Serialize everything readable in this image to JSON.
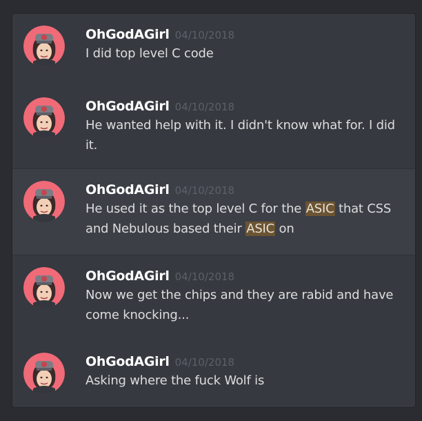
{
  "messages": [
    {
      "author": "OhGodAGirl",
      "timestamp": "04/10/2018",
      "parts": [
        {
          "text": "I did top level C code",
          "highlight": false
        }
      ]
    },
    {
      "author": "OhGodAGirl",
      "timestamp": "04/10/2018",
      "parts": [
        {
          "text": "He wanted help with it. I didn't know what for. I did it.",
          "highlight": false
        }
      ]
    },
    {
      "author": "OhGodAGirl",
      "timestamp": "04/10/2018",
      "highlighted": true,
      "parts": [
        {
          "text": "He used it as the top level C for the ",
          "highlight": false
        },
        {
          "text": "ASIC",
          "highlight": true
        },
        {
          "text": " that CSS and Nebulous based their ",
          "highlight": false
        },
        {
          "text": "ASIC",
          "highlight": true
        },
        {
          "text": " on",
          "highlight": false
        }
      ]
    },
    {
      "author": "OhGodAGirl",
      "timestamp": "04/10/2018",
      "parts": [
        {
          "text": "Now we get the chips and they are rabid and have come knocking...",
          "highlight": false
        }
      ]
    },
    {
      "author": "OhGodAGirl",
      "timestamp": "04/10/2018",
      "parts": [
        {
          "text": "Asking where the fuck Wolf is",
          "highlight": false
        }
      ]
    }
  ],
  "colors": {
    "background": "#2a2c31",
    "panel": "#36393f",
    "highlight_row": "#3c3f46",
    "mention_highlight": "#6b5433",
    "author": "#ffffff",
    "timestamp": "#5d6068",
    "text": "#dcddde",
    "avatar_ring": "#f06a78"
  },
  "icons": {
    "avatar": "avatar-icon"
  }
}
